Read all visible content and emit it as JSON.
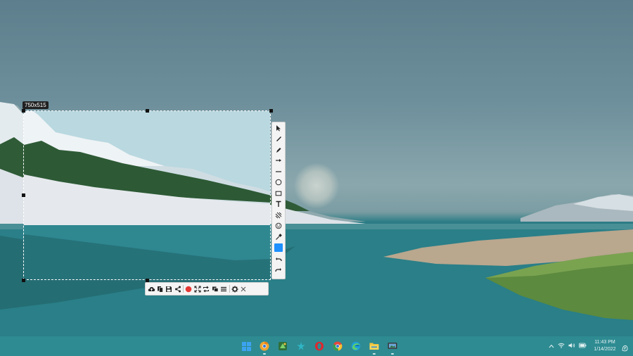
{
  "capture": {
    "dimensions_label": "750x515",
    "color_swatch": "#1e90ff",
    "record_color": "#e53935"
  },
  "vertical_toolbar": {
    "tools": [
      "select-arrow",
      "pen",
      "marker",
      "arrow",
      "line",
      "ellipse",
      "rectangle",
      "text",
      "blur",
      "emoji",
      "pipette",
      "color",
      "undo",
      "redo"
    ]
  },
  "horizontal_toolbar": {
    "tools": [
      "upload-cloud",
      "copy",
      "save",
      "share",
      "more",
      "record",
      "fullscreen",
      "repeat",
      "pin",
      "menu",
      "more2",
      "settings",
      "close"
    ]
  },
  "taskbar": {
    "apps": [
      "windows-start",
      "chrome-canary",
      "app-green",
      "app-star",
      "opera",
      "chrome",
      "edge",
      "file-explorer",
      "screenshot-app"
    ]
  },
  "tray": {
    "time": "11:43 PM",
    "date": "1/14/2022"
  }
}
